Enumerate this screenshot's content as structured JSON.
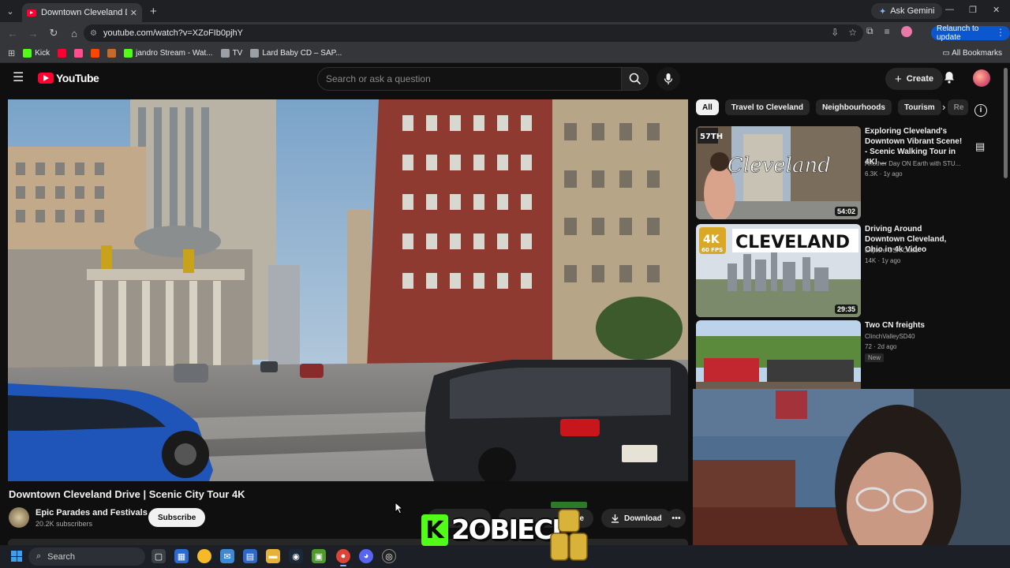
{
  "browser": {
    "tab_title": "Downtown Cleveland Drive | Sc",
    "ask_gemini": "Ask Gemini",
    "url": "youtube.com/watch?v=XZoFIb0pjhY",
    "relaunch": "Relaunch to update",
    "bookmarks": [
      {
        "label": "Kick",
        "color": "#53fc18"
      },
      {
        "label": "",
        "color": "#ff0033"
      },
      {
        "label": "",
        "color": "#ff4d8d"
      },
      {
        "label": "",
        "color": "#ff4500"
      },
      {
        "label": "",
        "color": "#c46a2a"
      },
      {
        "label": "jandro Stream - Wat...",
        "color": "#53fc18"
      },
      {
        "label": "TV",
        "color": "#9aa0a6"
      },
      {
        "label": "Lard Baby CD – SAP...",
        "color": "#9aa0a6"
      }
    ],
    "all_bookmarks": "All Bookmarks"
  },
  "youtube": {
    "logo_text": "YouTube",
    "search_placeholder": "Search or ask a question",
    "create_label": "Create",
    "video": {
      "title": "Downtown Cleveland Drive | Scenic City Tour 4K",
      "channel": "Epic Parades and Festivals",
      "subscribers": "20.2K subscribers",
      "subscribe_label": "Subscribe",
      "download_label": "Download",
      "partial_action_label": "e"
    },
    "chips": [
      "All",
      "Travel to Cleveland",
      "Neighbourhoods",
      "Tourism",
      "Re"
    ],
    "recommendations": [
      {
        "title": "Exploring Cleveland's Downtown Vibrant Scene! - Scenic Walking Tour in 4K! ...",
        "channel": "Another Day ON Earth with STU...",
        "meta": "6.3K · 1y ago",
        "duration": "54:02",
        "thumb_text": "Cleveland",
        "thumb_corner": "57TH"
      },
      {
        "title": "Driving Around Downtown Cleveland, Ohio in 4k Video",
        "channel": "Explore USA Cities",
        "meta": "14K · 1y ago",
        "duration": "29:35",
        "thumb_text": "CLEVELAND",
        "badge_top": "4K",
        "badge_bottom": "60 FPS"
      },
      {
        "title": "Two CN freights",
        "channel": "ClinchValleySD40",
        "meta": "72 · 2d ago",
        "badge": "New"
      }
    ]
  },
  "overlay": {
    "kick_letter": "K",
    "streamer_name": "2OBIECE"
  },
  "taskbar": {
    "search_label": "Search"
  },
  "colors": {
    "youtube_red": "#ff0033",
    "kick_green": "#53fc18",
    "chrome_blue": "#0b57d0"
  }
}
